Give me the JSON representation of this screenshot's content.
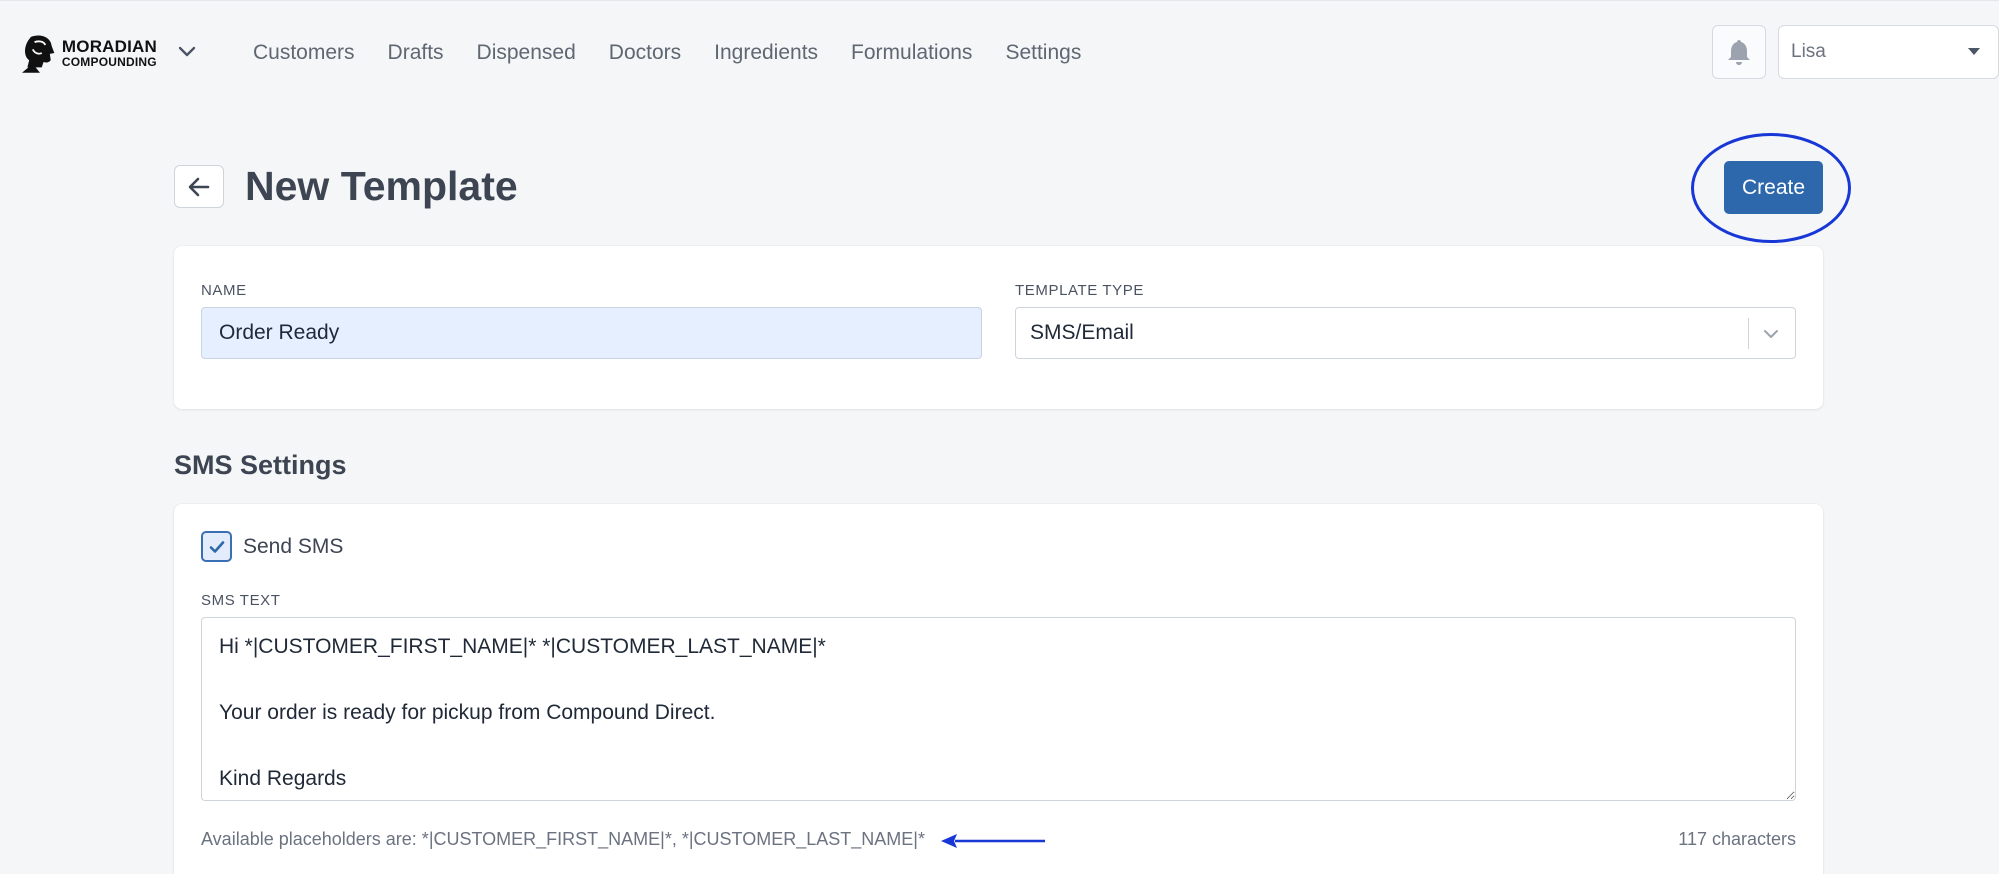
{
  "brand": {
    "line1": "MORADIAN",
    "line2": "COMPOUNDING"
  },
  "nav": {
    "items": [
      {
        "label": "Customers"
      },
      {
        "label": "Drafts"
      },
      {
        "label": "Dispensed"
      },
      {
        "label": "Doctors"
      },
      {
        "label": "Ingredients"
      },
      {
        "label": "Formulations"
      },
      {
        "label": "Settings"
      }
    ]
  },
  "user_menu": {
    "selected": "Lisa"
  },
  "header": {
    "title": "New Template",
    "create_label": "Create"
  },
  "form": {
    "name_label": "NAME",
    "name_value": "Order Ready",
    "type_label": "TEMPLATE TYPE",
    "type_value": "SMS/Email"
  },
  "sms": {
    "section_title": "SMS Settings",
    "send_sms_label": "Send SMS",
    "send_sms_checked": true,
    "text_label": "SMS TEXT",
    "text_value": "Hi *|CUSTOMER_FIRST_NAME|* *|CUSTOMER_LAST_NAME|*\n\nYour order is ready for pickup from Compound Direct.\n\nKind Regards",
    "placeholders_hint": "Available placeholders are: *|CUSTOMER_FIRST_NAME|*, *|CUSTOMER_LAST_NAME|*",
    "char_count": "117 characters"
  },
  "colors": {
    "primary": "#2d68ad",
    "annotation": "#1737d6",
    "name_input_bg": "#e6efff"
  },
  "icons": [
    "brand-logo-icon",
    "chevron-down-icon",
    "bell-icon",
    "caret-down-icon",
    "back-arrow-icon",
    "checkmark-icon",
    "annotation-arrow-icon"
  ]
}
